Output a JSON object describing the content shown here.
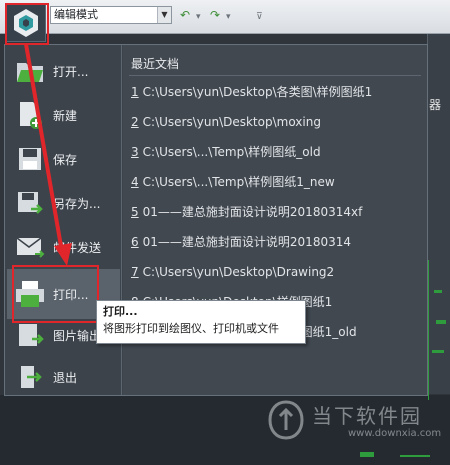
{
  "toolbar": {
    "mode_value": "编辑模式",
    "icons": [
      "undo-icon",
      "redo-icon",
      "dropdown-icon",
      "customize-icon"
    ]
  },
  "menu": {
    "items": [
      {
        "label": "打开...",
        "icon": "open-folder-icon"
      },
      {
        "label": "新建",
        "icon": "new-document-icon"
      },
      {
        "label": "保存",
        "icon": "save-icon"
      },
      {
        "label": "另存为...",
        "icon": "save-as-icon"
      },
      {
        "label": "邮件发送",
        "icon": "email-icon"
      },
      {
        "label": "打印...",
        "icon": "printer-icon"
      },
      {
        "label": "图片输出",
        "icon": "image-export-icon"
      },
      {
        "label": "退出",
        "icon": "exit-icon"
      }
    ]
  },
  "recent": {
    "title": "最近文档",
    "items": [
      {
        "num": "1",
        "path": "C:\\Users\\yun\\Desktop\\各类图\\样例图纸1"
      },
      {
        "num": "2",
        "path": "C:\\Users\\yun\\Desktop\\moxing"
      },
      {
        "num": "3",
        "path": "C:\\Users\\...\\Temp\\样例图纸_old"
      },
      {
        "num": "4",
        "path": "C:\\Users\\...\\Temp\\样例图纸1_new"
      },
      {
        "num": "5",
        "path": "01——建总施封面设计说明20180314xf"
      },
      {
        "num": "6",
        "path": "01——建总施封面设计说明20180314"
      },
      {
        "num": "7",
        "path": "C:\\Users\\yun\\Desktop\\Drawing2"
      },
      {
        "num": "8",
        "path": "C:\\Users\\yun\\Desktop\\样例图纸1"
      },
      {
        "num": "9",
        "path": "C:\\Users\\yun\\Desktop\\样例图纸1_old"
      }
    ]
  },
  "tooltip": {
    "title": "打印...",
    "description": "将图形打印到绘图仪、打印机或文件"
  },
  "ribbon": {
    "partial_label": "器"
  },
  "watermark": {
    "text": "当下软件园",
    "url": "www.downxia.com"
  },
  "colors": {
    "highlight": "#e0262a",
    "accent_green": "#3f8f3a"
  }
}
